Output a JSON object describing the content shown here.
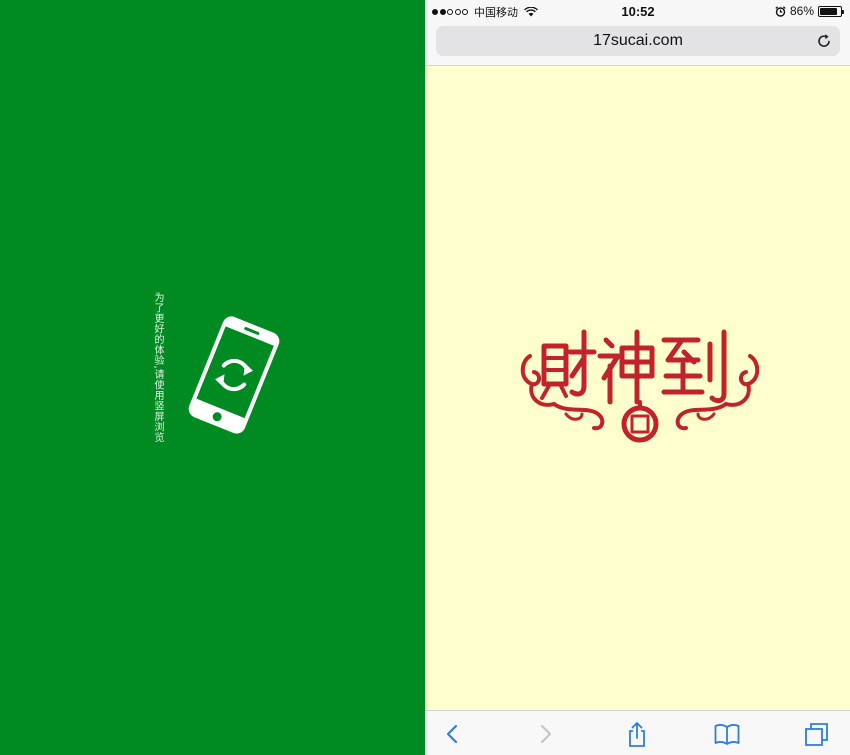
{
  "left": {
    "hint_text": "为了更好的体验,请使用竖屏浏览",
    "background": "#008b22",
    "icon": "rotate-phone-icon"
  },
  "status_bar": {
    "signal_filled": 2,
    "signal_total": 5,
    "carrier": "中国移动",
    "time": "10:52",
    "battery_percent": "86%",
    "battery_level": 0.86
  },
  "browser": {
    "url": "17sucai.com"
  },
  "page": {
    "background": "#fefecf",
    "logo_text": "財神到",
    "logo_color": "#c0242a"
  },
  "toolbar": {
    "icons": [
      "back-icon",
      "forward-icon",
      "share-icon",
      "bookmarks-icon",
      "tabs-icon"
    ],
    "accent": "#2f7fd8"
  }
}
